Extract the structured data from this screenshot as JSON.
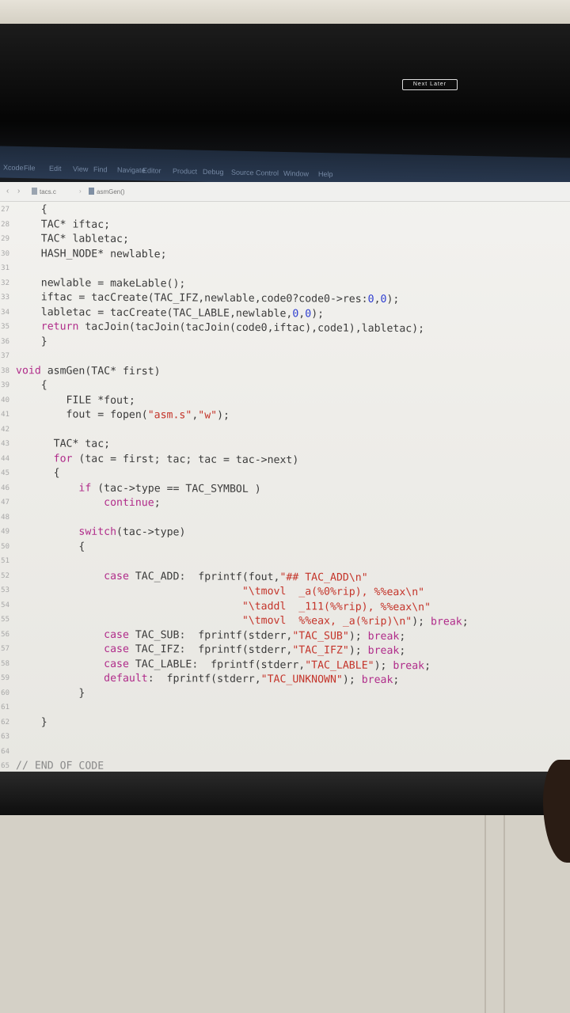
{
  "window": {
    "corner_label": "Next  Later"
  },
  "menubar": {
    "items": [
      "Xcode",
      "File",
      "Edit",
      "View",
      "Find",
      "Navigate",
      "Editor",
      "Product",
      "Debug",
      "Source Control",
      "Window",
      "Help"
    ]
  },
  "navbar": {
    "breadcrumb_file": "tacs.c",
    "breadcrumb_symbol": "asmGen()"
  },
  "code": {
    "lines": [
      {
        "n": "27",
        "t": "    {"
      },
      {
        "n": "28",
        "t": "    TAC* iftac;"
      },
      {
        "n": "29",
        "t": "    TAC* labletac;"
      },
      {
        "n": "30",
        "t": "    HASH_NODE* newlable;"
      },
      {
        "n": "31",
        "t": ""
      },
      {
        "n": "32",
        "t": "    newlable = makeLable();"
      },
      {
        "n": "33",
        "t": "    iftac = tacCreate(TAC_IFZ,newlable,code0?code0->res:0,0);"
      },
      {
        "n": "34",
        "t": "    labletac = tacCreate(TAC_LABLE,newlable,0,0);"
      },
      {
        "n": "35",
        "t": "    return tacJoin(tacJoin(tacJoin(code0,iftac),code1),labletac);"
      },
      {
        "n": "36",
        "t": "    }"
      },
      {
        "n": "37",
        "t": ""
      },
      {
        "n": "38",
        "t": "void asmGen(TAC* first)"
      },
      {
        "n": "39",
        "t": "    {"
      },
      {
        "n": "40",
        "t": "        FILE *fout;"
      },
      {
        "n": "41",
        "t": "        fout = fopen(\"asm.s\",\"w\");"
      },
      {
        "n": "42",
        "t": ""
      },
      {
        "n": "43",
        "t": "      TAC* tac;"
      },
      {
        "n": "44",
        "t": "      for (tac = first; tac; tac = tac->next)"
      },
      {
        "n": "45",
        "t": "      {"
      },
      {
        "n": "46",
        "t": "          if (tac->type == TAC_SYMBOL )"
      },
      {
        "n": "47",
        "t": "              continue;"
      },
      {
        "n": "48",
        "t": ""
      },
      {
        "n": "49",
        "t": "          switch(tac->type)"
      },
      {
        "n": "50",
        "t": "          {"
      },
      {
        "n": "51",
        "t": ""
      },
      {
        "n": "52",
        "t": "              case TAC_ADD:  fprintf(fout,\"## TAC_ADD\\n\""
      },
      {
        "n": "53",
        "t": "                                    \"\\tmovl  _a(%0%rip), %%eax\\n\""
      },
      {
        "n": "54",
        "t": "                                    \"\\taddl  _111(%%rip), %%eax\\n\""
      },
      {
        "n": "55",
        "t": "                                    \"\\tmovl  %%eax, _a(%rip)\\n\"); break;"
      },
      {
        "n": "56",
        "t": "              case TAC_SUB:  fprintf(stderr,\"TAC_SUB\"); break;"
      },
      {
        "n": "57",
        "t": "              case TAC_IFZ:  fprintf(stderr,\"TAC_IFZ\"); break;"
      },
      {
        "n": "58",
        "t": "              case TAC_LABLE:  fprintf(stderr,\"TAC_LABLE\"); break;"
      },
      {
        "n": "59",
        "t": "              default:  fprintf(stderr,\"TAC_UNKNOWN\"); break;"
      },
      {
        "n": "60",
        "t": "          }"
      },
      {
        "n": "61",
        "t": ""
      },
      {
        "n": "62",
        "t": "    }"
      },
      {
        "n": "63",
        "t": ""
      },
      {
        "n": "64",
        "t": ""
      },
      {
        "n": "65",
        "t": "// END OF CODE"
      }
    ]
  },
  "colors": {
    "keyword": "#b02c8a",
    "string": "#c4342a",
    "number": "#2c3cd0",
    "text": "#3b3b3b"
  }
}
